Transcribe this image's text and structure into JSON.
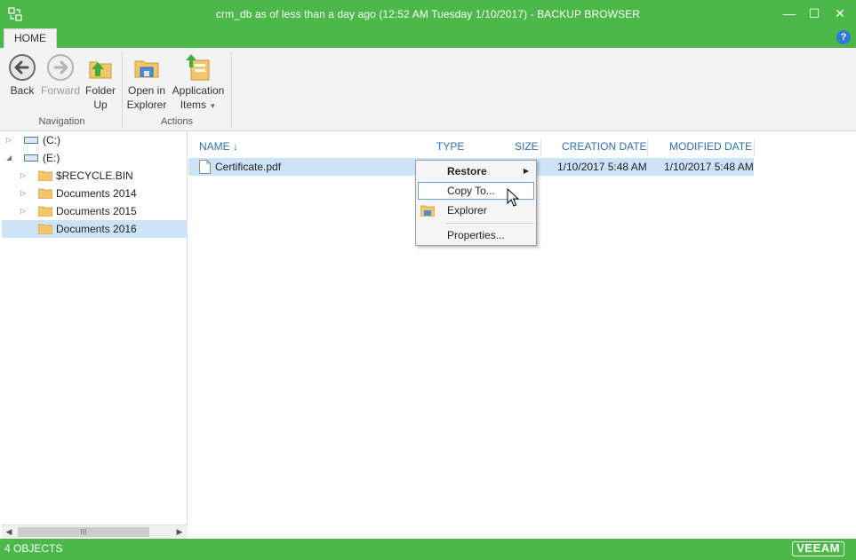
{
  "window": {
    "title": "crm_db as of less than a day ago (12:52 AM Tuesday 1/10/2017) - BACKUP BROWSER",
    "minimize": "—",
    "maximize": "☐",
    "close": "✕"
  },
  "tabs": {
    "home": "HOME",
    "help": "?"
  },
  "ribbon": {
    "navigation": {
      "label": "Navigation",
      "back": "Back",
      "forward": "Forward",
      "folder_up_line1": "Folder",
      "folder_up_line2": "Up"
    },
    "actions": {
      "label": "Actions",
      "open_explorer_line1": "Open in",
      "open_explorer_line2": "Explorer",
      "app_items_line1": "Application",
      "app_items_line2": "Items"
    }
  },
  "tree": {
    "items": [
      {
        "label": "(C:)"
      },
      {
        "label": "(E:)"
      },
      {
        "label": "$RECYCLE.BIN"
      },
      {
        "label": "Documents 2014"
      },
      {
        "label": "Documents 2015"
      },
      {
        "label": "Documents 2016"
      }
    ],
    "scroll_thumb": "III"
  },
  "list": {
    "columns": {
      "name": "NAME",
      "type": "TYPE",
      "size": "SIZE",
      "creation": "CREATION DATE",
      "modified": "MODIFIED DATE"
    },
    "rows": [
      {
        "name": "Certificate.pdf",
        "creation": "1/10/2017 5:48 AM",
        "modified": "1/10/2017 5:48 AM"
      }
    ]
  },
  "context_menu": {
    "restore": "Restore",
    "copy_to": "Copy To...",
    "explorer": "Explorer",
    "properties": "Properties..."
  },
  "status": {
    "count": "4 OBJECTS",
    "logo": "VEEAM"
  },
  "colors": {
    "accent": "#4cb849",
    "selection": "#cde4f7",
    "header_text": "#2c6fb3"
  }
}
